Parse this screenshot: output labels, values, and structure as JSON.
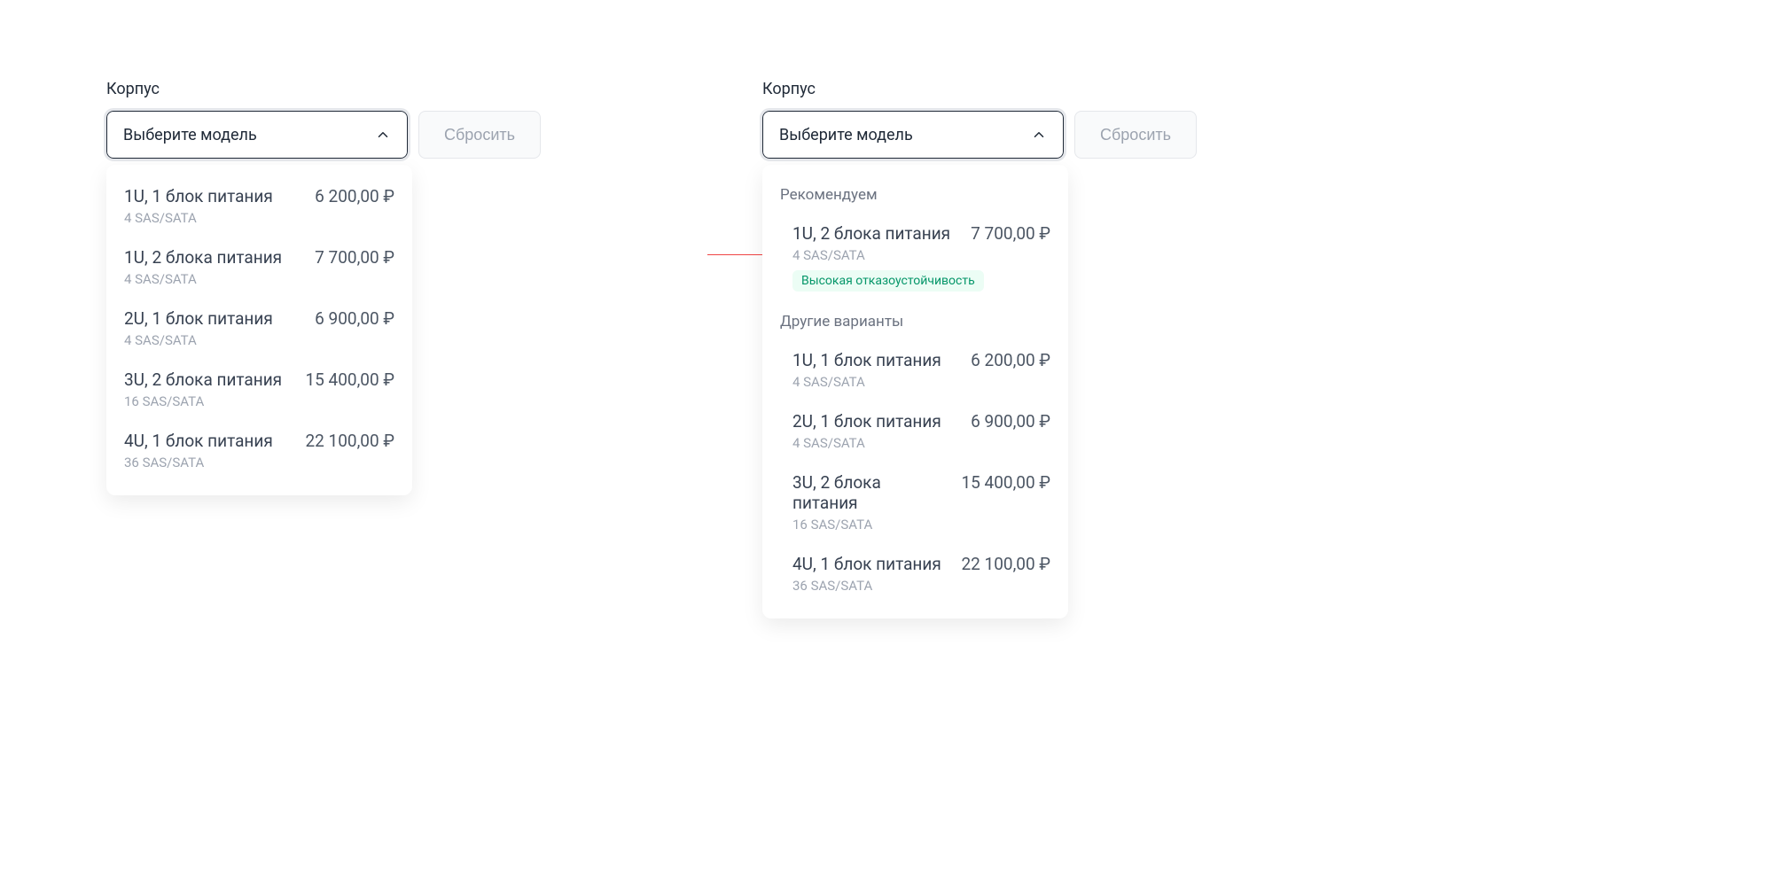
{
  "left": {
    "label": "Корпус",
    "placeholder": "Выберите модель",
    "reset": "Сбросить",
    "options": [
      {
        "title": "1U, 1 блок питания",
        "price": "6 200,00 ₽",
        "sub": "4 SAS/SATA"
      },
      {
        "title": "1U, 2 блока питания",
        "price": "7 700,00 ₽",
        "sub": "4 SAS/SATA"
      },
      {
        "title": "2U, 1 блок питания",
        "price": "6 900,00 ₽",
        "sub": "4 SAS/SATA"
      },
      {
        "title": "3U, 2 блока питания",
        "price": "15 400,00 ₽",
        "sub": "16 SAS/SATA"
      },
      {
        "title": "4U, 1 блок питания",
        "price": "22 100,00 ₽",
        "sub": "36 SAS/SATA"
      }
    ]
  },
  "right": {
    "label": "Корпус",
    "placeholder": "Выберите модель",
    "reset": "Сбросить",
    "section_recommended": "Рекомендуем",
    "recommended": {
      "title": "1U, 2 блока питания",
      "price": "7 700,00 ₽",
      "sub": "4 SAS/SATA",
      "badge": "Высокая отказоустойчивость"
    },
    "section_other": "Другие варианты",
    "other": [
      {
        "title": "1U, 1 блок питания",
        "price": "6 200,00 ₽",
        "sub": "4 SAS/SATA"
      },
      {
        "title": "2U, 1 блок питания",
        "price": "6 900,00 ₽",
        "sub": "4 SAS/SATA"
      },
      {
        "title": "3U, 2 блока питания",
        "price": "15 400,00 ₽",
        "sub": "16 SAS/SATA"
      },
      {
        "title": "4U, 1 блок питания",
        "price": "22 100,00 ₽",
        "sub": "36 SAS/SATA"
      }
    ]
  }
}
